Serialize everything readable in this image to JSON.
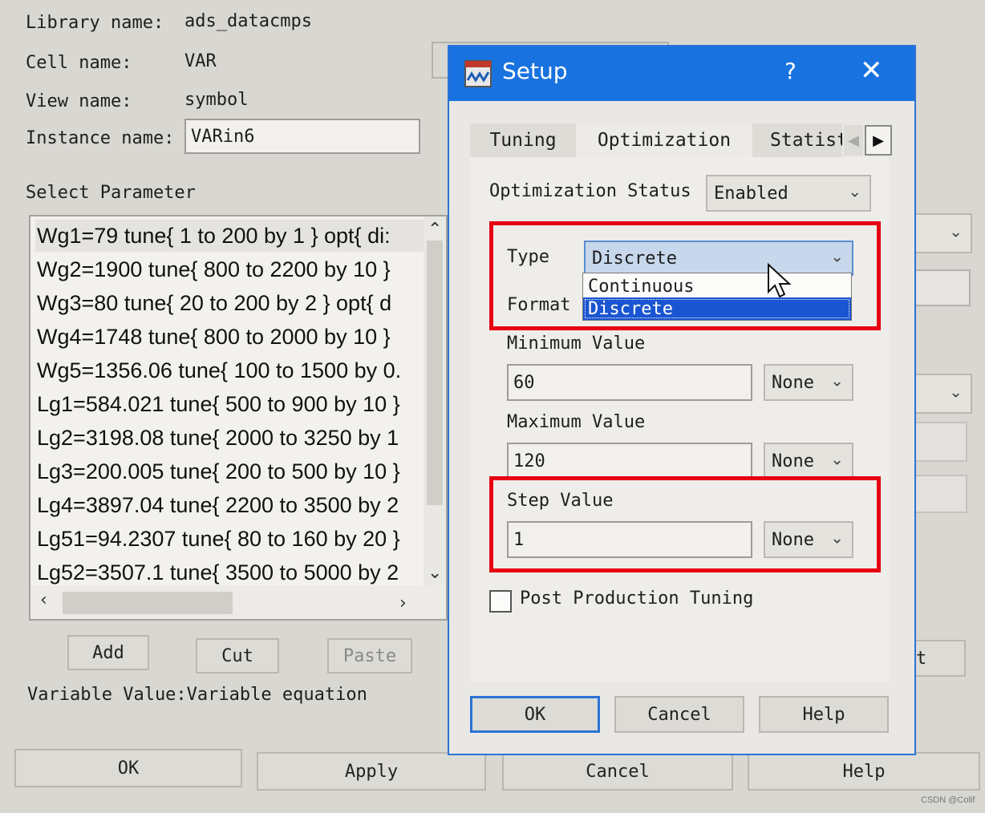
{
  "main": {
    "library_label": "Library name:",
    "library_value": "ads_datacmps",
    "cell_label": "Cell name:",
    "cell_value": "VAR",
    "view_label": "View name:",
    "view_value": "symbol",
    "instance_label": "Instance name:",
    "instance_value": "VARin6",
    "select_param_label": "Select Parameter",
    "params": [
      "Wg1=79 tune{ 1 to 200 by 1 } opt{ di:",
      "Wg2=1900 tune{ 800 to 2200 by 10 }",
      "Wg3=80 tune{ 20 to 200 by 2 } opt{ d",
      "Wg4=1748 tune{ 800 to 2000 by 10 }",
      "Wg5=1356.06 tune{ 100 to 1500 by 0.",
      "Lg1=584.021 tune{ 500 to 900 by 10 }",
      "Lg2=3198.08 tune{ 2000 to 3250 by 1",
      "Lg3=200.005 tune{ 200 to 500 by 10 }",
      "Lg4=3897.04 tune{ 2200 to 3500 by 2",
      "Lg51=94.2307 tune{ 80 to 160 by 20 }",
      "Lg52=3507.1 tune{ 3500 to 5000 by 2"
    ],
    "add_label": "Add",
    "cut_label": "Cut",
    "paste_label": "Paste",
    "variable_text": "Variable Value:Variable equation",
    "ok_label": "OK",
    "apply_label": "Apply",
    "cancel_label": "Cancel",
    "help_label": "Help",
    "partial_t": "t"
  },
  "dialog": {
    "title": "Setup",
    "help_glyph": "?",
    "close_glyph": "✕",
    "tabs": [
      "Tuning",
      "Optimization",
      "Statist"
    ],
    "opt_status_label": "Optimization Status",
    "opt_status_value": "Enabled",
    "type_label": "Type",
    "type_value": "Discrete",
    "type_options": [
      "Continuous",
      "Discrete"
    ],
    "format_label": "Format",
    "min_label": "Minimum Value",
    "min_value": "60",
    "min_unit": "None",
    "max_label": "Maximum Value",
    "max_value": "120",
    "max_unit": "None",
    "step_label": "Step Value",
    "step_value": "1",
    "step_unit": "None",
    "post_prod_label": "Post Production Tuning",
    "ok_label": "OK",
    "cancel_label": "Cancel",
    "help_label": "Help"
  },
  "watermark": "CSDN @Colif",
  "colors": {
    "titlebar": "#1873e0",
    "highlight_box": "#e60012",
    "selection": "#1a55d1"
  }
}
